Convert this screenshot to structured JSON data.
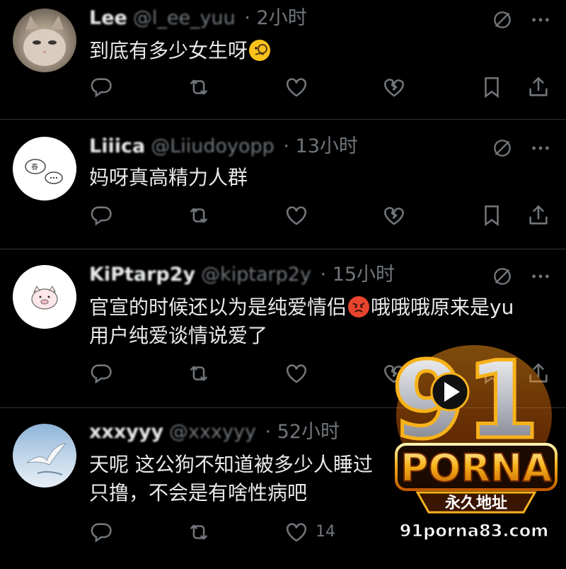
{
  "tweets": [
    {
      "name": "Lee",
      "handle": "@l_ee_yuu",
      "time": "2小时",
      "text": "到底有多少女生呀",
      "emoji": "monocle-face-emoji",
      "like_count": ""
    },
    {
      "name": "Liiica",
      "handle": "@Liiudoyopp",
      "time": "13小时",
      "text": "妈呀真高精力人群",
      "like_count": ""
    },
    {
      "name": "KiPtarp2y",
      "handle": "@kiptarp2y",
      "time": "15小时",
      "text_line1_before": "官宣的时候还以为是纯爱情侣",
      "emoji": "angry-face-emoji",
      "text_line1_after": "哦哦哦原来是yu",
      "text_line2": "用户纯爱谈情说爱了",
      "like_count": ""
    },
    {
      "name": "xxxyyy",
      "handle": "@xxxyyy",
      "time": "52小时",
      "text_line1": "天呢 这公狗不知道被多少人睡过",
      "text_line2": "只撸，不会是有啥性病吧",
      "like_count": "14"
    }
  ],
  "watermark": {
    "number": "91",
    "brand": "PORNA",
    "subtitle": "永久地址",
    "url": "91porna83.com"
  },
  "colors": {
    "background": "#000000",
    "text": "#e7e9ea",
    "muted": "#71767b",
    "divider": "#2f3336",
    "watermark_gold": "#f7b21b",
    "watermark_orange": "#ff6a00"
  }
}
